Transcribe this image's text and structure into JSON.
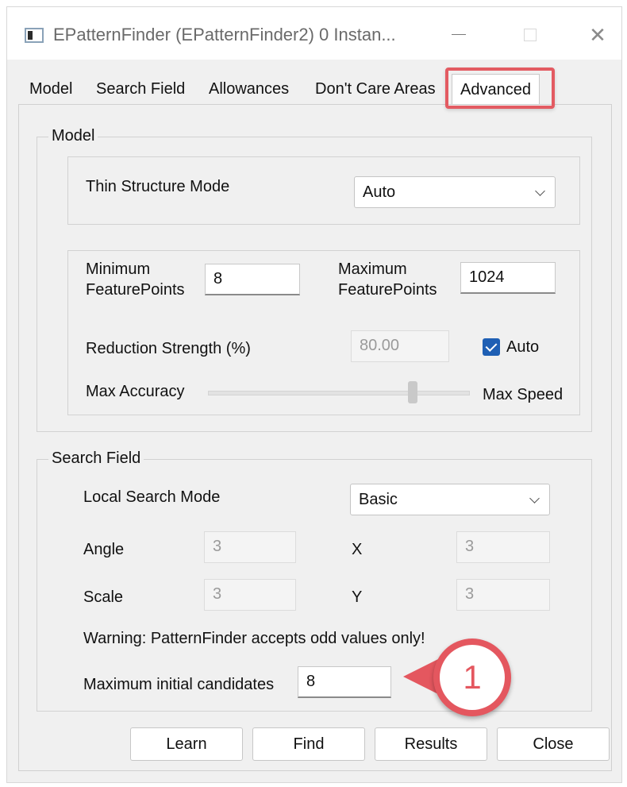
{
  "window": {
    "title": "EPatternFinder (EPatternFinder2) 0 Instan...",
    "close_glyph": "✕"
  },
  "tabs": [
    {
      "label": "Model"
    },
    {
      "label": "Search Field"
    },
    {
      "label": "Allowances"
    },
    {
      "label": "Don't Care Areas"
    },
    {
      "label": "Advanced",
      "active": true
    }
  ],
  "colors": {
    "highlight": "#e35b62",
    "checkbox": "#1e5fb4",
    "callout": "#e4575f"
  },
  "model_group": {
    "title": "Model",
    "thin_structure": {
      "label": "Thin Structure Mode",
      "value": "Auto"
    },
    "min_feature_points": {
      "label_line1": "Minimum",
      "label_line2": "FeaturePoints",
      "value": "8"
    },
    "max_feature_points": {
      "label_line1": "Maximum",
      "label_line2": "FeaturePoints",
      "value": "1024"
    },
    "reduction_strength": {
      "label": "Reduction Strength (%)",
      "value": "80.00",
      "auto_label": "Auto",
      "auto_checked": true
    },
    "accuracy_slider": {
      "left_label": "Max Accuracy",
      "right_label": "Max Speed",
      "position_fraction": 0.78
    }
  },
  "search_group": {
    "title": "Search Field",
    "local_search_mode": {
      "label": "Local Search Mode",
      "value": "Basic"
    },
    "angle": {
      "label": "Angle",
      "value": "3"
    },
    "x": {
      "label": "X",
      "value": "3"
    },
    "scale": {
      "label": "Scale",
      "value": "3"
    },
    "y": {
      "label": "Y",
      "value": "3"
    },
    "warning": "Warning: PatternFinder accepts odd values only!",
    "max_candidates": {
      "label": "Maximum initial candidates",
      "value": "8"
    }
  },
  "buttons": {
    "learn": "Learn",
    "find": "Find",
    "results": "Results",
    "close": "Close"
  },
  "callout": {
    "number": "1"
  }
}
